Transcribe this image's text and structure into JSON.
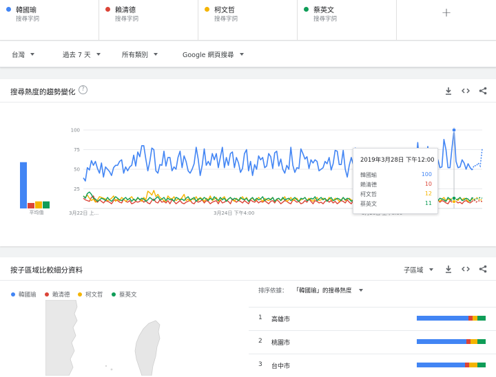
{
  "terms": [
    {
      "name": "韓國瑜",
      "sub": "搜尋字詞",
      "color": "#4285f4"
    },
    {
      "name": "賴清德",
      "sub": "搜尋字詞",
      "color": "#db4437"
    },
    {
      "name": "柯文哲",
      "sub": "搜尋字詞",
      "color": "#f4b400"
    },
    {
      "name": "蔡英文",
      "sub": "搜尋字詞",
      "color": "#0f9d58"
    }
  ],
  "add_label": "+",
  "filters": {
    "region": "台灣",
    "time": "過去 7 天",
    "category": "所有類別",
    "property": "Google 網頁搜尋"
  },
  "trend": {
    "title": "搜尋熱度的趨勢變化",
    "help": "?",
    "avg_label": "平均值",
    "tools": [
      "download-icon",
      "embed-icon",
      "share-icon"
    ]
  },
  "chart_data": {
    "type": "line",
    "ylim": [
      0,
      100
    ],
    "yticks": [
      25,
      50,
      75,
      100
    ],
    "xtick_labels": [
      "3月22日 上...",
      "3月24日 下午4:00",
      "3月26日 上午8:00"
    ],
    "averages": [
      {
        "name": "韓國瑜",
        "value": 59
      },
      {
        "name": "賴清德",
        "value": 7
      },
      {
        "name": "柯文哲",
        "value": 9
      },
      {
        "name": "蔡英文",
        "value": 9
      }
    ],
    "series": [
      {
        "name": "韓國瑜",
        "values": [
          39,
          35,
          52,
          49,
          61,
          55,
          60,
          51,
          45,
          58,
          40,
          53,
          50,
          47,
          42,
          52,
          55,
          55,
          60,
          62,
          45,
          53,
          48,
          53,
          55,
          68,
          54,
          72,
          66,
          80,
          80,
          63,
          48,
          60,
          77,
          75,
          48,
          45,
          56,
          55,
          73,
          54,
          65,
          65,
          48,
          53,
          50,
          65,
          73,
          52,
          67,
          60,
          48,
          45,
          50,
          57,
          78,
          63,
          42,
          55,
          76,
          55,
          60,
          55,
          70,
          62,
          70,
          52,
          65,
          78,
          52,
          65,
          55,
          70,
          72,
          52,
          65,
          58,
          46,
          51,
          70,
          75,
          48,
          60,
          42,
          56,
          50,
          67,
          62,
          65,
          52,
          54,
          70,
          66,
          51,
          71,
          73,
          54,
          63,
          50,
          45,
          55,
          50,
          78,
          55,
          46,
          52,
          51,
          76,
          70,
          63,
          66,
          51,
          62,
          58,
          62,
          60,
          48,
          50,
          52,
          60,
          57,
          65,
          49,
          57,
          74,
          73,
          56,
          56,
          74,
          50,
          40,
          55,
          65,
          56,
          77,
          52,
          55,
          64,
          50,
          45,
          55,
          63,
          50,
          52,
          53,
          52,
          55,
          72,
          59,
          60,
          55,
          58,
          46,
          70,
          74,
          50,
          60,
          56,
          52,
          63,
          58,
          62,
          64,
          56,
          54,
          84,
          55,
          52,
          60,
          57,
          79,
          55,
          54,
          55,
          68,
          62,
          52,
          53,
          88,
          75,
          52,
          52,
          77,
          100,
          60,
          52,
          53,
          62,
          58,
          50,
          57,
          52,
          49,
          55,
          54,
          58,
          54,
          76
        ]
      },
      {
        "name": "賴清德",
        "values": [
          13,
          11,
          10,
          9,
          14,
          16,
          9,
          8,
          11,
          9,
          7,
          10,
          9,
          8,
          6,
          10,
          11,
          10,
          8,
          7,
          12,
          9,
          8,
          10,
          6,
          7,
          9,
          8,
          9,
          11,
          8,
          10,
          7,
          6,
          10,
          12,
          8,
          7,
          11,
          8,
          9,
          7,
          10,
          6,
          11,
          9,
          6,
          8,
          10,
          7,
          6,
          8,
          9,
          11,
          7,
          6,
          10,
          8,
          9,
          11,
          7,
          10,
          9,
          6,
          8,
          9,
          10,
          6,
          11,
          7,
          8,
          10,
          9,
          6,
          12,
          10,
          8,
          10,
          9,
          7,
          10,
          8,
          6,
          11,
          9,
          8,
          10,
          7,
          9,
          8,
          10,
          8,
          6,
          9,
          10,
          7,
          11,
          9,
          6,
          8,
          10,
          9,
          7,
          6,
          11,
          10,
          8,
          9,
          6,
          7,
          10,
          8,
          12,
          9,
          6,
          10,
          9,
          7,
          8,
          6,
          9,
          11,
          8,
          10,
          7,
          9,
          6,
          8,
          10,
          9,
          7,
          11,
          8,
          6,
          10,
          9,
          8,
          7,
          10,
          8,
          9,
          6,
          11,
          9,
          8,
          7,
          10,
          9,
          6,
          8,
          11,
          9,
          10,
          7,
          8,
          6,
          10,
          9,
          8,
          11,
          7,
          9,
          10,
          6,
          8,
          9,
          11,
          7,
          6,
          10,
          9,
          8,
          10,
          7,
          9,
          6,
          11,
          8,
          10,
          9,
          7,
          6,
          10,
          8,
          10,
          9,
          7,
          8,
          6,
          9,
          10,
          8,
          7,
          9,
          11,
          8,
          10,
          9,
          9
        ]
      },
      {
        "name": "柯文哲",
        "values": [
          16,
          14,
          17,
          13,
          10,
          12,
          8,
          11,
          15,
          14,
          13,
          12,
          10,
          11,
          13,
          16,
          9,
          12,
          10,
          14,
          12,
          9,
          11,
          13,
          15,
          11,
          10,
          13,
          12,
          9,
          14,
          11,
          22,
          20,
          17,
          23,
          15,
          18,
          14,
          12,
          10,
          9,
          16,
          13,
          12,
          15,
          10,
          12,
          11,
          14,
          18,
          10,
          12,
          9,
          13,
          11,
          15,
          10,
          14,
          12,
          9,
          13,
          11,
          16,
          10,
          12,
          14,
          9,
          11,
          13,
          15,
          10,
          12,
          14,
          11,
          9,
          13,
          10,
          12,
          15,
          11,
          14,
          9,
          12,
          13,
          10,
          11,
          14,
          12,
          9,
          13,
          11,
          10,
          12,
          14,
          9,
          11,
          13,
          10,
          12,
          15,
          9,
          11,
          14,
          10,
          12,
          13,
          9,
          11,
          12,
          14,
          10,
          13,
          11,
          9,
          12,
          14,
          10,
          11,
          13,
          12,
          9,
          14,
          11,
          10,
          13,
          12,
          9,
          11,
          14,
          10,
          12,
          13,
          11,
          9,
          12,
          14,
          10,
          11,
          13,
          12,
          9,
          10,
          14,
          11,
          12,
          13,
          9,
          10,
          12,
          14,
          11,
          9,
          13,
          12,
          10,
          11,
          14,
          9,
          12,
          13,
          10,
          11,
          12,
          14,
          9,
          11,
          13,
          10,
          12,
          11,
          14,
          9,
          12,
          13,
          10,
          11,
          9,
          12,
          14,
          10,
          12,
          11,
          13,
          9,
          12,
          10,
          14,
          11,
          13,
          12,
          9,
          10,
          12,
          11,
          14,
          13,
          10,
          12
        ]
      },
      {
        "name": "蔡英文",
        "values": [
          16,
          13,
          19,
          21,
          18,
          13,
          12,
          9,
          11,
          13,
          12,
          10,
          14,
          11,
          9,
          12,
          15,
          13,
          11,
          10,
          12,
          14,
          11,
          13,
          9,
          12,
          10,
          14,
          11,
          13,
          12,
          9,
          11,
          14,
          12,
          10,
          13,
          15,
          11,
          12,
          14,
          10,
          13,
          11,
          12,
          9,
          14,
          13,
          11,
          12,
          10,
          13,
          15,
          11,
          12,
          14,
          9,
          12,
          13,
          11,
          14,
          12,
          10,
          13,
          11,
          15,
          12,
          10,
          14,
          11,
          13,
          9,
          12,
          14,
          11,
          13,
          12,
          10,
          14,
          12,
          11,
          13,
          9,
          12,
          14,
          10,
          13,
          11,
          12,
          15,
          10,
          12,
          13,
          11,
          14,
          9,
          12,
          13,
          10,
          14,
          11,
          12,
          13,
          10,
          12,
          14,
          11,
          9,
          13,
          12,
          14,
          10,
          11,
          13,
          12,
          15,
          10,
          12,
          14,
          11,
          13,
          9,
          12,
          14,
          10,
          11,
          13,
          12,
          10,
          14,
          11,
          13,
          12,
          9,
          11,
          14,
          12,
          10,
          13,
          11,
          12,
          14,
          10,
          13,
          11,
          12,
          15,
          9,
          12,
          13,
          11,
          14,
          10,
          12,
          13,
          11,
          9,
          14,
          12,
          11,
          13,
          10,
          12,
          14,
          11,
          13,
          12,
          10,
          11,
          14,
          12,
          9,
          13,
          11,
          12,
          14,
          10,
          13,
          12,
          11,
          9,
          14,
          12,
          10,
          13,
          11,
          12,
          14,
          10,
          11,
          13,
          12,
          9,
          14,
          11,
          12,
          13,
          14,
          13
        ]
      }
    ],
    "highlight_index": 184
  },
  "tooltip": {
    "date": "2019年3月28日 下午12:00",
    "rows": [
      {
        "name": "韓國瑜",
        "value": "100",
        "color": "#4285f4"
      },
      {
        "name": "賴清德",
        "value": "10",
        "color": "#db4437"
      },
      {
        "name": "柯文哲",
        "value": "12",
        "color": "#f4b400"
      },
      {
        "name": "蔡英文",
        "value": "11",
        "color": "#0f9d58"
      }
    ]
  },
  "region": {
    "title": "按子區域比較細分資料",
    "subregion_label": "子區域",
    "legend": [
      "韓國瑜",
      "賴清德",
      "柯文哲",
      "蔡英文"
    ],
    "sort_label": "排序依據：",
    "sort_value": "「韓國瑜」的搜尋熱度",
    "rows": [
      {
        "rank": "1",
        "city": "高雄市",
        "shares": [
          0.75,
          0.06,
          0.07,
          0.12
        ]
      },
      {
        "rank": "2",
        "city": "桃園市",
        "shares": [
          0.72,
          0.06,
          0.1,
          0.12
        ]
      },
      {
        "rank": "3",
        "city": "台中市",
        "shares": [
          0.7,
          0.06,
          0.12,
          0.12
        ]
      }
    ]
  }
}
